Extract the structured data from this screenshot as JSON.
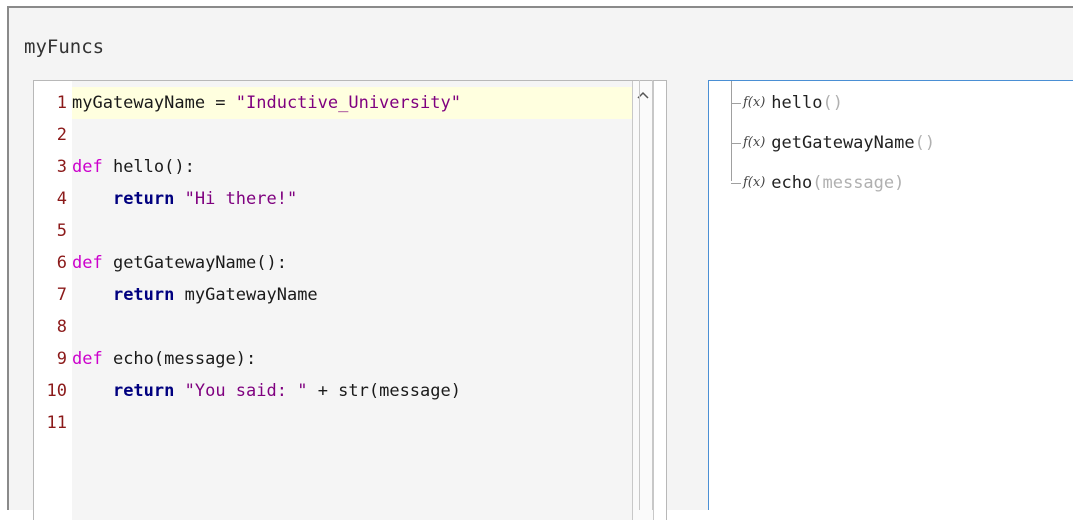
{
  "panel": {
    "title": "myFuncs"
  },
  "editor": {
    "lines": [
      {
        "num": "1",
        "tokens": [
          {
            "t": "myGatewayName = ",
            "c": ""
          },
          {
            "t": "\"Inductive_University\"",
            "c": "str"
          }
        ]
      },
      {
        "num": "2",
        "tokens": []
      },
      {
        "num": "3",
        "tokens": [
          {
            "t": "def",
            "c": "kw-def"
          },
          {
            "t": " hello():",
            "c": ""
          }
        ]
      },
      {
        "num": "4",
        "tokens": [
          {
            "t": "    ",
            "c": ""
          },
          {
            "t": "return",
            "c": "kw-ret"
          },
          {
            "t": " ",
            "c": ""
          },
          {
            "t": "\"Hi there!\"",
            "c": "str"
          }
        ]
      },
      {
        "num": "5",
        "tokens": []
      },
      {
        "num": "6",
        "tokens": [
          {
            "t": "def",
            "c": "kw-def"
          },
          {
            "t": " getGatewayName():",
            "c": ""
          }
        ]
      },
      {
        "num": "7",
        "tokens": [
          {
            "t": "    ",
            "c": ""
          },
          {
            "t": "return",
            "c": "kw-ret"
          },
          {
            "t": " myGatewayName",
            "c": ""
          }
        ]
      },
      {
        "num": "8",
        "tokens": []
      },
      {
        "num": "9",
        "tokens": [
          {
            "t": "def",
            "c": "kw-def"
          },
          {
            "t": " echo(message):",
            "c": ""
          }
        ]
      },
      {
        "num": "10",
        "tokens": [
          {
            "t": "    ",
            "c": ""
          },
          {
            "t": "return",
            "c": "kw-ret"
          },
          {
            "t": " ",
            "c": ""
          },
          {
            "t": "\"You said: \"",
            "c": "str"
          },
          {
            "t": " + str(message)",
            "c": ""
          }
        ]
      },
      {
        "num": "11",
        "tokens": []
      }
    ],
    "scroll_up_icon": "chevron-up-icon"
  },
  "function_tree": {
    "items": [
      {
        "icon": "function-icon",
        "icon_glyph": "f(x)",
        "name": "hello",
        "args": "()"
      },
      {
        "icon": "function-icon",
        "icon_glyph": "f(x)",
        "name": "getGatewayName",
        "args": "()"
      },
      {
        "icon": "function-icon",
        "icon_glyph": "f(x)",
        "name": "echo",
        "args": "(message)"
      }
    ]
  },
  "colors": {
    "keyword_def": "#cc00cc",
    "keyword_return": "#00007f",
    "string": "#7f007f",
    "line_number": "#8b1a1a",
    "current_line": "#ffffdf",
    "tree_border": "#4a8fd4"
  }
}
